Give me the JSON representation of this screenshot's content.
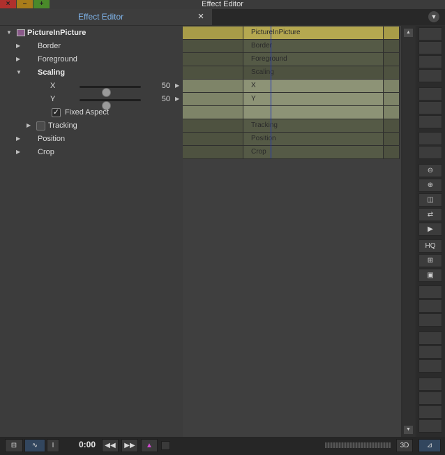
{
  "window": {
    "title": "Effect Editor",
    "close_glyph": "×",
    "min_glyph": "–",
    "max_glyph": "+"
  },
  "tab": {
    "label": "Effect Editor",
    "close_glyph": "×",
    "menu_glyph": "▼"
  },
  "tree": {
    "root": "PictureInPicture",
    "border": "Border",
    "foreground": "Foreground",
    "scaling": "Scaling",
    "x_label": "X",
    "x_value": "50",
    "x_level": 0.5,
    "y_label": "Y",
    "y_value": "50",
    "y_level": 0.5,
    "fixed_aspect": "Fixed Aspect",
    "fixed_aspect_checked": true,
    "tracking": "Tracking",
    "position": "Position",
    "crop": "Crop"
  },
  "timeline": {
    "rows": [
      "PictureInPicture",
      "Border",
      "Foreground",
      "Scaling",
      "X",
      "Y",
      "",
      "Tracking",
      "Position",
      "Crop"
    ]
  },
  "tools": {
    "zoom_out": "🔍−",
    "zoom_in": "🔍+",
    "hq_label": "HQ"
  },
  "bottom": {
    "timecode": "0:00"
  },
  "colors": {
    "accent_tab": "#7fb4ea",
    "root_row": "#a89c48",
    "row_dark": "#4e5240",
    "row_light": "#7e8468",
    "playhead": "#2136b8"
  }
}
